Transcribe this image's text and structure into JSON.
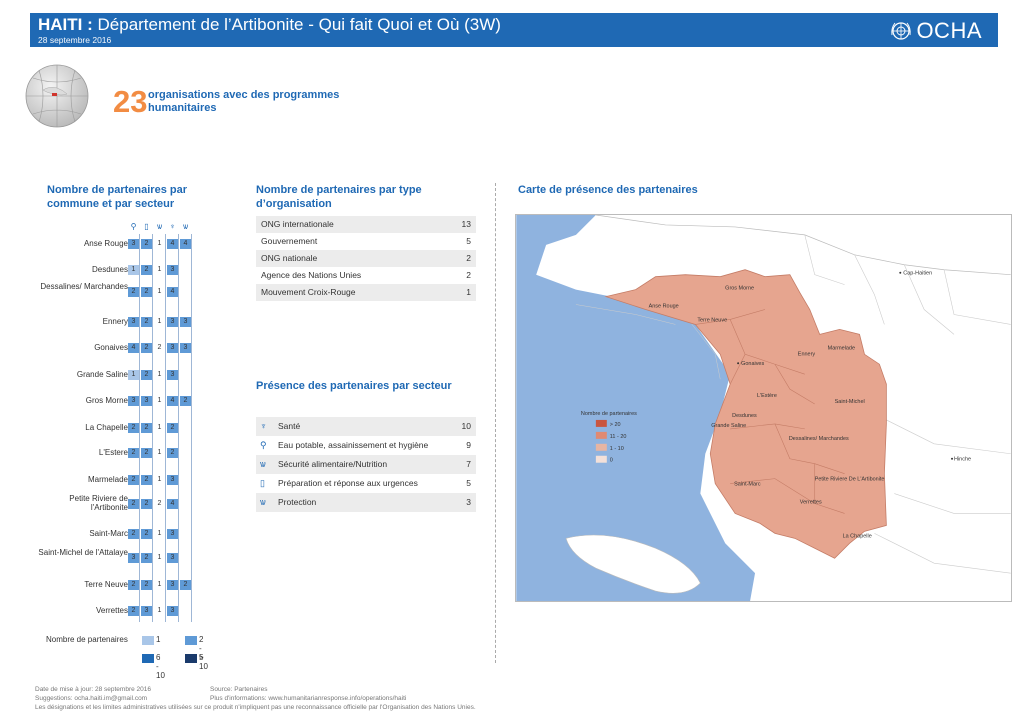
{
  "header": {
    "title_bold": "HAITI :",
    "title_rest": " Département de l’Artibonite - Qui fait Quoi et Où (3W)",
    "date": "28 septembre 2016",
    "logo_text": "OCHA",
    "bg_color": "#1f69b4"
  },
  "summary": {
    "count": "23",
    "label": "organisations avec des programmes humanitaires",
    "count_color": "#f28c43"
  },
  "commune_section": {
    "title": "Nombre de partenaires par commune et par secteur",
    "sector_icons": [
      "water-tap-icon",
      "food-kit-icon",
      "protection-icon",
      "health-icon",
      "food-security-icon"
    ],
    "rows": [
      {
        "name": "Anse Rouge",
        "values": [
          "3",
          "2",
          "1",
          "4",
          "4"
        ]
      },
      {
        "name": "Desdunes",
        "values": [
          "1",
          "2",
          "1",
          "3",
          ""
        ]
      },
      {
        "name": "Dessalines/ Marchandes",
        "values": [
          "2",
          "2",
          "1",
          "4",
          ""
        ]
      },
      {
        "name": "Ennery",
        "values": [
          "3",
          "2",
          "1",
          "3",
          "3"
        ]
      },
      {
        "name": "Gonaives",
        "values": [
          "4",
          "2",
          "2",
          "3",
          "3"
        ]
      },
      {
        "name": "Grande Saline",
        "values": [
          "1",
          "2",
          "1",
          "3",
          ""
        ]
      },
      {
        "name": "Gros Morne",
        "values": [
          "3",
          "3",
          "1",
          "4",
          "2"
        ]
      },
      {
        "name": "La Chapelle",
        "values": [
          "2",
          "2",
          "1",
          "2",
          ""
        ]
      },
      {
        "name": "L'Estere",
        "values": [
          "2",
          "2",
          "1",
          "2",
          ""
        ]
      },
      {
        "name": "Marmelade",
        "values": [
          "2",
          "2",
          "1",
          "3",
          ""
        ]
      },
      {
        "name": "Petite Riviere de l'Artibonite",
        "values": [
          "2",
          "2",
          "2",
          "4",
          ""
        ]
      },
      {
        "name": "Saint-Marc",
        "values": [
          "2",
          "2",
          "1",
          "3",
          ""
        ]
      },
      {
        "name": "Saint-Michel de l'Attalaye",
        "values": [
          "3",
          "2",
          "1",
          "3",
          ""
        ]
      },
      {
        "name": "Terre Neuve",
        "values": [
          "2",
          "2",
          "1",
          "3",
          "2"
        ]
      },
      {
        "name": "Verrettes",
        "values": [
          "2",
          "3",
          "1",
          "3",
          ""
        ]
      }
    ],
    "legend_title": "Nombre de partenaires",
    "legend_items": [
      "1",
      "2 - 5",
      "6 - 10",
      "> 10"
    ],
    "legend_colors": [
      "#a9c6e8",
      "#5f9ad6",
      "#1f69b4",
      "#1a3a6b"
    ]
  },
  "type_section": {
    "title": "Nombre de partenaires par type d’organisation",
    "rows": [
      {
        "label": "ONG internationale",
        "value": "13"
      },
      {
        "label": "Gouvernement",
        "value": "5"
      },
      {
        "label": "ONG nationale",
        "value": "2"
      },
      {
        "label": "Agence des Nations Unies",
        "value": "2"
      },
      {
        "label": "Mouvement Croix-Rouge",
        "value": "1"
      }
    ]
  },
  "sector_section": {
    "title": "Présence des partenaires par secteur",
    "rows": [
      {
        "icon": "health-icon",
        "label": "Santé",
        "value": "10"
      },
      {
        "icon": "water-tap-icon",
        "label": "Eau potable, assainissement et hygiène",
        "value": "9"
      },
      {
        "icon": "food-security-icon",
        "label": "Sécurité alimentaire/Nutrition",
        "value": "7"
      },
      {
        "icon": "emergency-kit-icon",
        "label": "Préparation et réponse aux urgences",
        "value": "5"
      },
      {
        "icon": "protection-icon",
        "label": "Protection",
        "value": "3"
      }
    ]
  },
  "map_section": {
    "title": "Carte de présence des partenaires",
    "legend_title": "Nombre de partenaires",
    "legend_items": [
      "> 20",
      "11 - 20",
      "1 - 10",
      "0"
    ],
    "legend_colors": [
      "#c9553f",
      "#e08a73",
      "#e6b5a3",
      "#f3e0d9"
    ],
    "labels": [
      "Cap-Haitien",
      "Gros Morne",
      "Anse Rouge",
      "Terre Neuve",
      "Marmelade",
      "Ennery",
      "Gonaives",
      "L'Estère",
      "Saint-Michel",
      "Desdunes",
      "Grande Saline",
      "Dessalines/ Marchandes",
      "Hinche",
      "Saint-Marc",
      "Petite Riviere De L'Artibonite",
      "Verrettes",
      "La Chapelle"
    ],
    "water_color": "#8fb3df",
    "region_color": "#e6a58f"
  },
  "footer": {
    "line1": "Date de mise à jour: 28 septembre 2016",
    "source": "Source: Partenaires",
    "suggestions": "Suggestions: ocha.haiti.im@gmail.com",
    "info": "Plus d'informations: www.humanitarianresponse.info/operations/haiti",
    "disclaimer": "Les désignations et les limites administratives utilisées sur ce produit n'impliquent pas une reconnaissance officielle par l'Organisation des Nations Unies."
  }
}
